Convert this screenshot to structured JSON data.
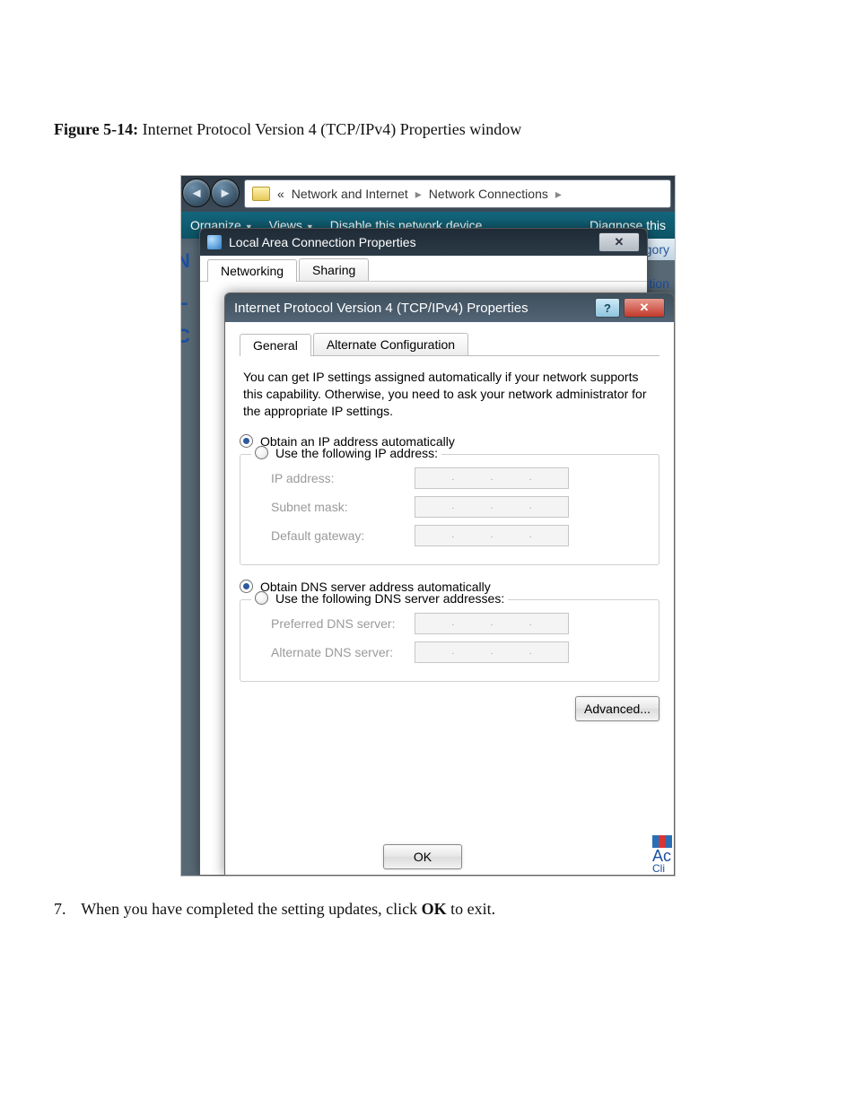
{
  "caption": {
    "label": "Figure 5-14:",
    "text": "Internet Protocol Version 4 (TCP/IPv4) Properties window"
  },
  "explorer": {
    "breadcrumb": {
      "chev": "«",
      "seg1": "Network and Internet",
      "sep": "▸",
      "seg2": "Network Connections",
      "tail": "▸"
    },
    "toolbar": {
      "organize": "Organize",
      "views": "Views",
      "disable": "Disable this network device",
      "diagnose": "Diagnose this"
    },
    "category_fragment": "rk Category",
    "left_letters": [
      "N",
      "L",
      "C"
    ],
    "connection_fragment": "nnection"
  },
  "lac": {
    "title": "Local Area Connection Properties",
    "close_glyph": "✕",
    "tabs": {
      "networking": "Networking",
      "sharing": "Sharing"
    }
  },
  "ipv4": {
    "title": "Internet Protocol Version 4 (TCP/IPv4) Properties",
    "help_glyph": "?",
    "close_glyph": "✕",
    "tabs": {
      "general": "General",
      "altconf": "Alternate Configuration"
    },
    "description": "You can get IP settings assigned automatically if your network supports this capability. Otherwise, you need to ask your network administrator for the appropriate IP settings.",
    "ip": {
      "auto": "Obtain an IP address automatically",
      "manual": "Use the following IP address:",
      "fields": {
        "ip": "IP address:",
        "mask": "Subnet mask:",
        "gw": "Default gateway:"
      }
    },
    "dns": {
      "auto": "Obtain DNS server address automatically",
      "manual": "Use the following DNS server addresses:",
      "fields": {
        "pref": "Preferred DNS server:",
        "alt": "Alternate DNS server:"
      }
    },
    "buttons": {
      "advanced": "Advanced...",
      "ok": "OK"
    }
  },
  "corner": {
    "line1": "Ac",
    "line2": "Cli"
  },
  "step": {
    "num": "7.",
    "pre": "When you have completed the setting updates, click ",
    "bold": "OK",
    "post": " to exit."
  }
}
